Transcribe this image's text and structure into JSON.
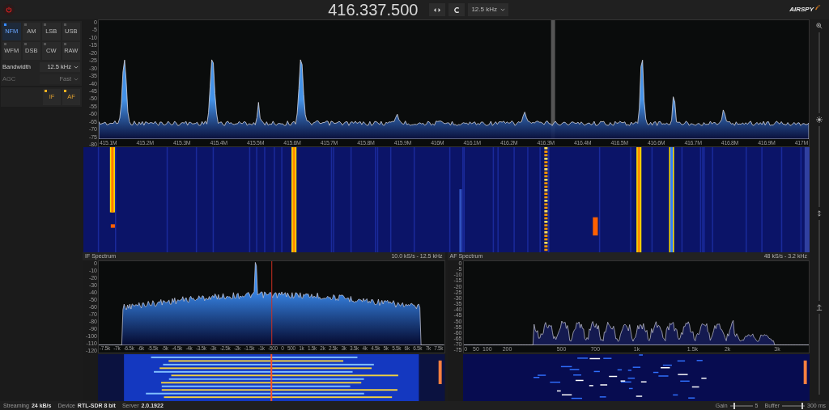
{
  "top_bar": {
    "frequency": "416.337.500",
    "step": "12.5 kHz",
    "logo": "AIRSPY"
  },
  "demodulator": {
    "modes": [
      {
        "label": "NFM",
        "selected": true
      },
      {
        "label": "AM",
        "selected": false
      },
      {
        "label": "LSB",
        "selected": false
      },
      {
        "label": "USB",
        "selected": false
      },
      {
        "label": "WFM",
        "selected": false
      },
      {
        "label": "DSB",
        "selected": false
      },
      {
        "label": "CW",
        "selected": false
      },
      {
        "label": "RAW",
        "selected": false
      }
    ],
    "bandwidth": {
      "label": "Bandwidth",
      "value": "12.5 kHz",
      "disabled": false
    },
    "agc": {
      "label": "AGC",
      "value": "Fast",
      "disabled": true
    },
    "outputs": [
      {
        "label": "IF",
        "on": true
      },
      {
        "label": "AF",
        "on": true
      }
    ]
  },
  "spectrum": {
    "y_labels": [
      "0",
      "-5",
      "-10",
      "-15",
      "-20",
      "-25",
      "-30",
      "-35",
      "-40",
      "-45",
      "-50",
      "-55",
      "-60",
      "-65",
      "-70",
      "-75",
      "-80"
    ],
    "x_labels": [
      "415.1M",
      "415.2M",
      "415.3M",
      "415.4M",
      "415.5M",
      "415.6M",
      "415.7M",
      "415.8M",
      "415.9M",
      "416M",
      "416.1M",
      "416.2M",
      "416.3M",
      "416.4M",
      "416.5M",
      "416.6M",
      "416.7M",
      "416.8M",
      "416.9M",
      "417M"
    ]
  },
  "if_panel": {
    "title": "IF Spectrum",
    "info": "10.0 kS/s - 12.5 kHz",
    "y_labels": [
      "0",
      "-10",
      "-20",
      "-30",
      "-40",
      "-50",
      "-60",
      "-70",
      "-80",
      "-90",
      "-100",
      "-110",
      "-120"
    ],
    "x_labels": [
      "-7.5k",
      "-7k",
      "-6.5k",
      "-6k",
      "-5.5k",
      "-5k",
      "-4.5k",
      "-4k",
      "-3.5k",
      "-3k",
      "-2.5k",
      "-2k",
      "-1.5k",
      "-1k",
      "-500",
      "0",
      "500",
      "1k",
      "1.5k",
      "2k",
      "2.5k",
      "3k",
      "3.5k",
      "4k",
      "4.5k",
      "5k",
      "5.5k",
      "6k",
      "6.5k",
      "7k",
      "7.5k"
    ]
  },
  "af_panel": {
    "title": "AF Spectrum",
    "info": "48 kS/s - 3.2 kHz",
    "y_labels": [
      "0",
      "-5",
      "-10",
      "-15",
      "-20",
      "-25",
      "-30",
      "-35",
      "-40",
      "-45",
      "-50",
      "-55",
      "-60",
      "-65",
      "-70",
      "-75"
    ],
    "x_labels": [
      "0",
      "50",
      "100",
      "200",
      "500",
      "700",
      "1k",
      "1.5k",
      "2k",
      "3k"
    ]
  },
  "status_bar": {
    "items": [
      {
        "label": "Streaming",
        "value": "24 kB/s"
      },
      {
        "label": "Device",
        "value": "RTL-SDR 8 bit"
      },
      {
        "label": "Server",
        "value": "2.0.1922"
      }
    ],
    "gain": {
      "label": "Gain",
      "value": "5",
      "level": 0.15
    },
    "buffer": {
      "label": "Buffer",
      "value": "300 ms",
      "level": 0.85
    }
  }
}
